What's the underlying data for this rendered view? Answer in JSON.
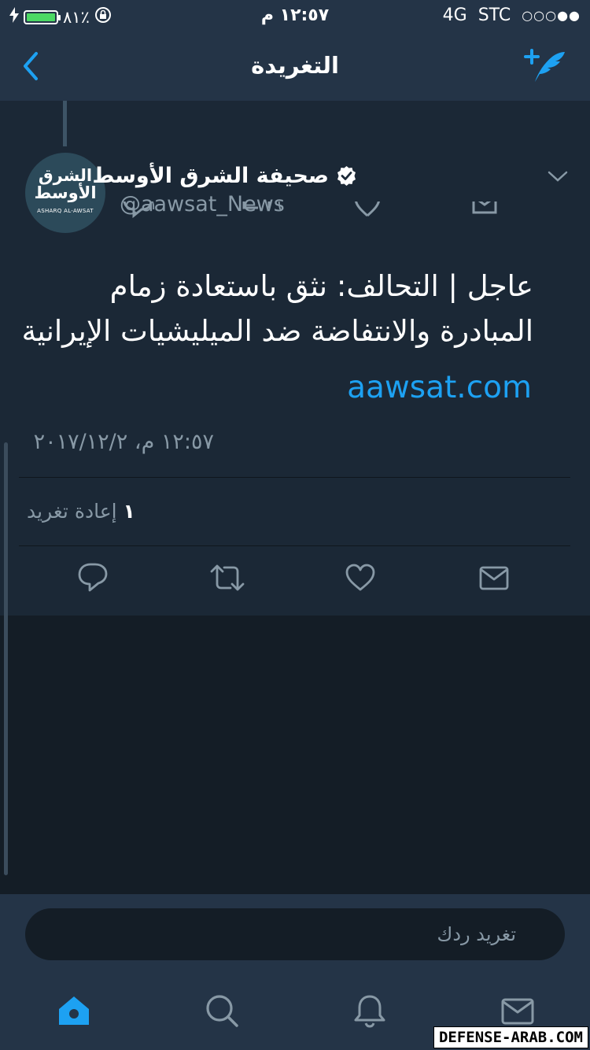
{
  "status_bar": {
    "battery": "٨١٪",
    "time": "١٢:٥٧ م",
    "network": "4G",
    "carrier": "STC",
    "signal": "○○○●●"
  },
  "nav": {
    "title": "التغريدة",
    "back_icon": "chevron-left-icon",
    "compose_icon": "compose-quill-icon"
  },
  "previous_tweet": {
    "reply_count": "١",
    "retweet_count": "٦"
  },
  "tweet": {
    "avatar": {
      "logo_line1": "الشرق",
      "logo_line2": "الأوسط",
      "logo_en": "ASHARQ AL-AWSAT"
    },
    "display_name": "صحيفة الشرق الأوسط",
    "handle": "@aawsat_News",
    "verified": true,
    "text": "عاجل | التحالف: نثق باستعادة زمام المبادرة والانتفاضة ضد الميليشيات الإيرانية",
    "link": "aawsat.com",
    "timestamp": "١٢:٥٧ م، ٢٠١٧/١٢/٢",
    "retweets_number": "١",
    "retweets_label": "إعادة تغريد",
    "actions": [
      "reply-icon",
      "retweet-icon",
      "like-icon",
      "message-icon"
    ]
  },
  "reply": {
    "placeholder": "تغريد ردك"
  },
  "tabs": [
    "home-icon",
    "search-icon",
    "notifications-icon",
    "messages-icon"
  ],
  "watermark": "DEFENSE-ARAB.COM",
  "colors": {
    "accent": "#1da1f2",
    "background": "#141d26",
    "surface": "#1b2836",
    "bar": "#243447",
    "secondary_text": "#8899a6"
  }
}
